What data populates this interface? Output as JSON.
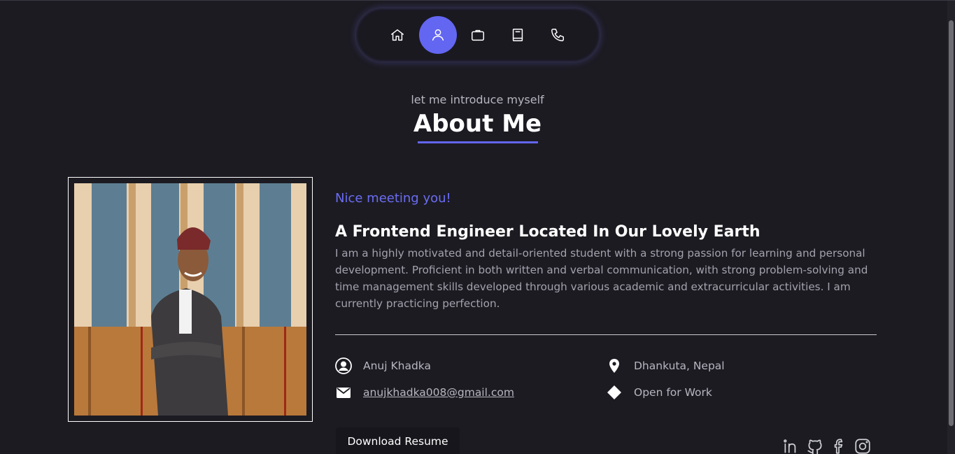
{
  "nav": {
    "items": [
      {
        "icon": "home-icon"
      },
      {
        "icon": "user-icon",
        "active": true
      },
      {
        "icon": "briefcase-icon"
      },
      {
        "icon": "book-icon"
      },
      {
        "icon": "phone-icon"
      }
    ]
  },
  "header": {
    "subtitle": "let me introduce myself",
    "title": "About Me"
  },
  "about": {
    "greeting": "Nice meeting you!",
    "headline": "A Frontend Engineer Located In Our Lovely Earth",
    "bio": "I am a highly motivated and detail-oriented student with a strong passion for learning and personal development. Proficient in both written and verbal communication, with strong problem-solving and time management skills developed through various academic and extracurricular activities. I am currently practicing perfection.",
    "name": "Anuj Khadka",
    "location": "Dhankuta, Nepal",
    "email": "anujkhadka008@gmail.com",
    "status": "Open for Work",
    "download_label": "Download Resume"
  },
  "socials": [
    "linkedin-icon",
    "github-icon",
    "facebook-icon",
    "instagram-icon"
  ],
  "colors": {
    "background": "#1c1b22",
    "accent": "#6366f1"
  }
}
